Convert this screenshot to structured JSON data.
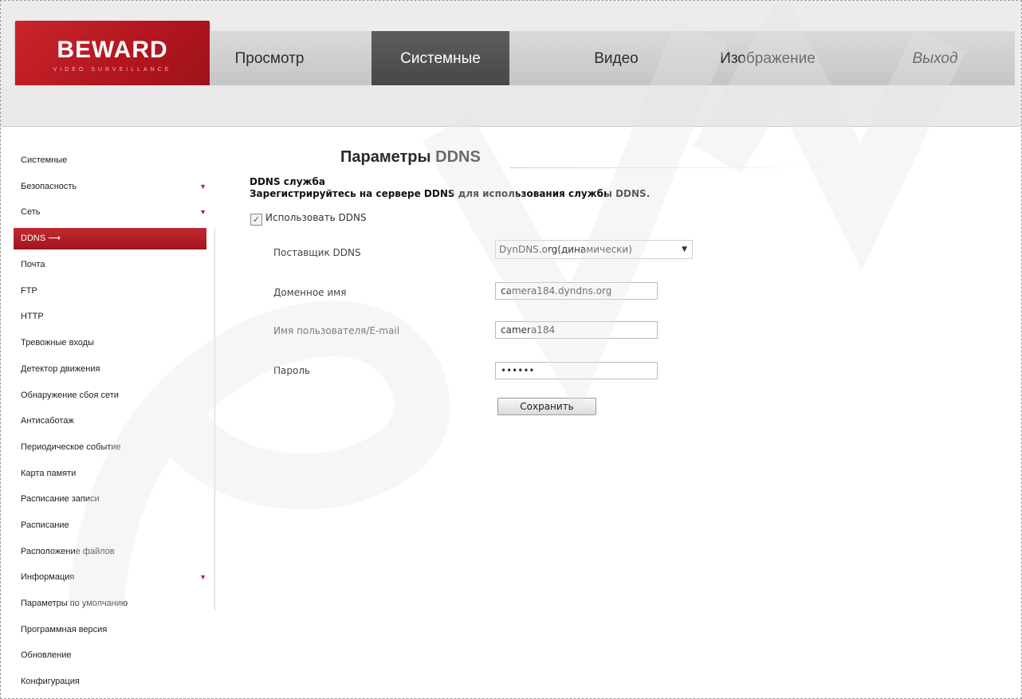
{
  "brand": {
    "logo_text": "BEWARD",
    "logo_sub": "VIDEO SURVEILLANCE",
    "accent": "#b71c24"
  },
  "nav": {
    "items": [
      {
        "label": "Просмотр"
      },
      {
        "label": "Системные"
      },
      {
        "label": "Видео"
      },
      {
        "label": "Изображение"
      },
      {
        "label": "Выход"
      }
    ],
    "active_index": 1
  },
  "sidebar": {
    "items": [
      {
        "label": "Системные"
      },
      {
        "label": "Безопасность"
      },
      {
        "label": "Сеть"
      },
      {
        "label": "DDNS"
      },
      {
        "label": "Почта"
      },
      {
        "label": "FTP"
      },
      {
        "label": "HTTP"
      },
      {
        "label": "Тревожные входы"
      },
      {
        "label": "Детектор движения"
      },
      {
        "label": "Обнаружение сбоя сети"
      },
      {
        "label": "Антисаботаж"
      },
      {
        "label": "Периодическое событие"
      },
      {
        "label": "Карта памяти"
      },
      {
        "label": "Расписание записи"
      },
      {
        "label": "Расписание"
      },
      {
        "label": "Расположение файлов"
      },
      {
        "label": "Информация"
      },
      {
        "label": "Параметры по умолчанию"
      },
      {
        "label": "Программная версия"
      },
      {
        "label": "Обновление"
      },
      {
        "label": "Конфигурация"
      }
    ],
    "active_marker": "⟶"
  },
  "main": {
    "title": "Параметры DDNS",
    "section_title": "DDNS служба",
    "section_hint": "Зарегистрируйтесь на сервере DDNS для использования службы DDNS.",
    "use_ddns_label": "Использовать DDNS",
    "use_ddns_checked": true,
    "provider_label": "Поставщик DDNS",
    "provider_value": "DynDNS.org(динамически)",
    "domain_label": "Доменное имя",
    "domain_value": "camera184.dyndns.org",
    "user_label": "Имя пользователя/E-mail",
    "user_value": "camera184",
    "password_label": "Пароль",
    "password_value": "••••••",
    "save_label": "Сохранить"
  },
  "icons": {
    "expand": "chevron-down-icon",
    "checkbox": "check-icon"
  }
}
